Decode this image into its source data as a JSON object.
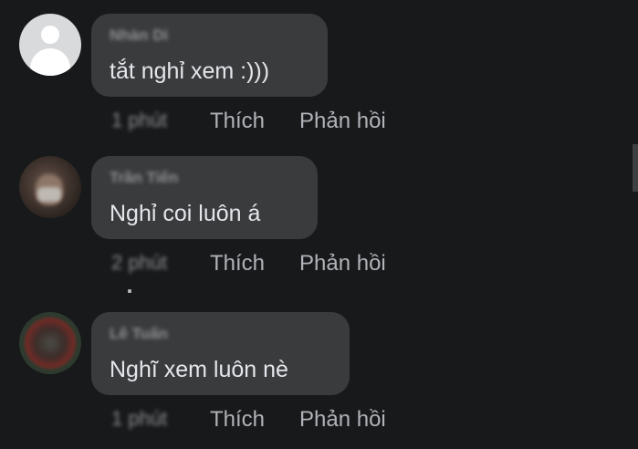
{
  "comments": [
    {
      "author": "Nhàn Di",
      "text": "tắt nghỉ xem :)))",
      "time": "1 phút",
      "like_label": "Thích",
      "reply_label": "Phản hồi"
    },
    {
      "author": "Trần Tiến",
      "text": "Nghỉ coi luôn á",
      "time": "2 phút",
      "like_label": "Thích",
      "reply_label": "Phản hồi"
    },
    {
      "author": "Lê Tuấn",
      "text": "Nghĩ xem luôn nè",
      "time": "1 phút",
      "like_label": "Thích",
      "reply_label": "Phản hồi"
    }
  ],
  "avatars": [
    "default-avatar",
    "profile-photo",
    "profile-photo"
  ]
}
